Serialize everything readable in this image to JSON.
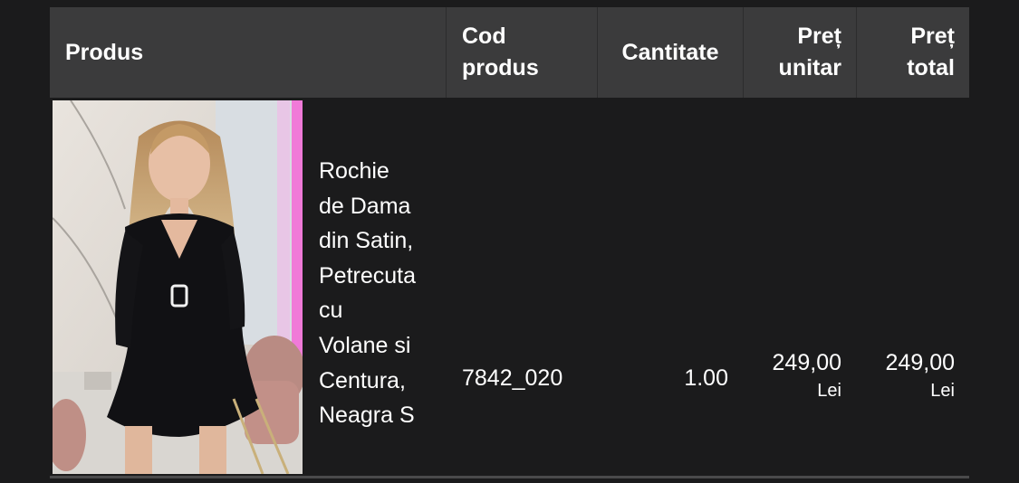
{
  "table": {
    "headers": {
      "product": "Produs",
      "code_line1": "Cod",
      "code_line2": "produs",
      "quantity": "Cantitate",
      "unit_price_line1": "Preț",
      "unit_price_line2": "unitar",
      "total_price_line1": "Preț",
      "total_price_line2": "total"
    },
    "rows": [
      {
        "name_lines": [
          "Rochie",
          "de Dama",
          "din Satin,",
          "Petrecuta",
          "cu",
          "Volane si",
          "Centura,",
          "Neagra S"
        ],
        "code": "7842_020",
        "quantity": "1.00",
        "unit_price": "249,00",
        "unit_currency": "Lei",
        "total_price": "249,00",
        "total_currency": "Lei"
      }
    ]
  },
  "colors": {
    "background": "#1b1b1c",
    "header_background": "#3b3b3c",
    "text": "#ffffff",
    "accent_pink": "#f07ad8"
  }
}
